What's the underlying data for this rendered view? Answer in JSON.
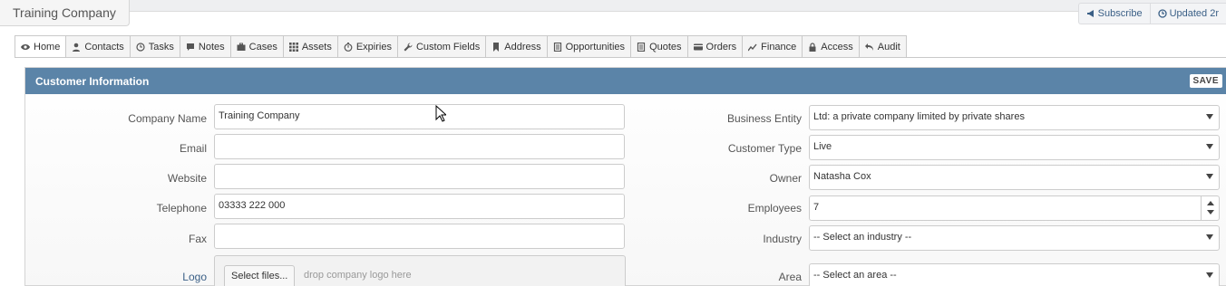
{
  "page_title": "Training Company",
  "top_actions": [
    {
      "label": "Subscribe",
      "icon": "megaphone-icon"
    },
    {
      "label": "Updated 2r",
      "icon": "clock-icon"
    }
  ],
  "tabs": [
    {
      "label": "Home",
      "icon": "eye-icon",
      "active": true
    },
    {
      "label": "Contacts",
      "icon": "user-icon"
    },
    {
      "label": "Tasks",
      "icon": "clock-icon"
    },
    {
      "label": "Notes",
      "icon": "comment-icon"
    },
    {
      "label": "Cases",
      "icon": "briefcase-icon"
    },
    {
      "label": "Assets",
      "icon": "grid-icon"
    },
    {
      "label": "Expiries",
      "icon": "timer-icon"
    },
    {
      "label": "Custom Fields",
      "icon": "wrench-icon"
    },
    {
      "label": "Address",
      "icon": "bookmark-icon"
    },
    {
      "label": "Opportunities",
      "icon": "document-icon"
    },
    {
      "label": "Quotes",
      "icon": "document-icon"
    },
    {
      "label": "Orders",
      "icon": "credit-card-icon"
    },
    {
      "label": "Finance",
      "icon": "line-chart-icon"
    },
    {
      "label": "Access",
      "icon": "lock-icon"
    },
    {
      "label": "Audit",
      "icon": "undo-icon"
    }
  ],
  "panel": {
    "title": "Customer Information",
    "save_label": "SAVE"
  },
  "left_fields": {
    "company_name": {
      "label": "Company Name",
      "value": "Training Company"
    },
    "email": {
      "label": "Email",
      "value": ""
    },
    "website": {
      "label": "Website",
      "value": ""
    },
    "telephone": {
      "label": "Telephone",
      "value": "03333 222 000"
    },
    "fax": {
      "label": "Fax",
      "value": ""
    },
    "logo": {
      "label": "Logo",
      "button": "Select files...",
      "hint": "drop company logo here"
    }
  },
  "right_fields": {
    "business_entity": {
      "label": "Business Entity",
      "value": "Ltd: a private company limited by private shares"
    },
    "customer_type": {
      "label": "Customer Type",
      "value": "Live"
    },
    "owner": {
      "label": "Owner",
      "value": "Natasha Cox"
    },
    "employees": {
      "label": "Employees",
      "value": "7"
    },
    "industry": {
      "label": "Industry",
      "value": "-- Select an industry --"
    },
    "area": {
      "label": "Area",
      "value": "-- Select an area --"
    }
  },
  "colors": {
    "header_blue": "#5b84a8",
    "link_blue": "#3a5f86"
  }
}
